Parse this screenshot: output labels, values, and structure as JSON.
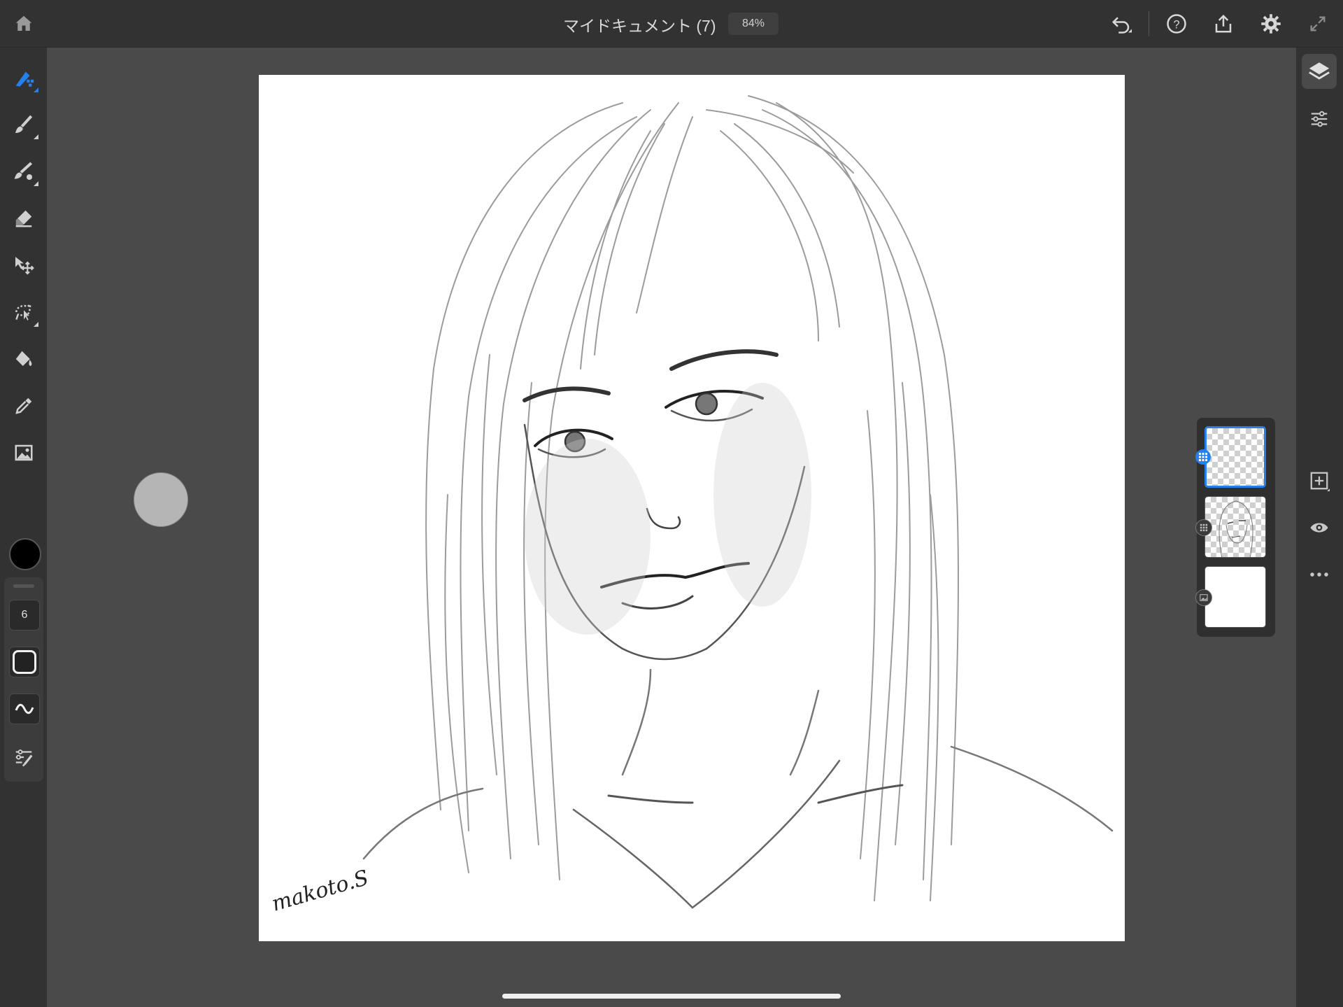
{
  "app": {
    "document_title": "マイドキュメント (7)",
    "zoom_level": "84%"
  },
  "toolbar_top": {
    "home": "home-icon",
    "undo": "undo-icon",
    "help": "help-icon",
    "share": "share-icon",
    "settings": "gear-icon",
    "fullscreen": "expand-icon"
  },
  "tools": [
    {
      "name": "pixel-brush",
      "icon": "pixel-brush-icon",
      "active": true
    },
    {
      "name": "live-brush",
      "icon": "live-brush-icon"
    },
    {
      "name": "vector-brush",
      "icon": "vector-brush-icon"
    },
    {
      "name": "eraser",
      "icon": "eraser-icon"
    },
    {
      "name": "transform",
      "icon": "transform-icon"
    },
    {
      "name": "selection",
      "icon": "lasso-icon"
    },
    {
      "name": "fill",
      "icon": "fill-bucket-icon"
    },
    {
      "name": "eyedropper",
      "icon": "eyedropper-icon"
    },
    {
      "name": "place-image",
      "icon": "image-icon"
    }
  ],
  "brush": {
    "color": "#000000",
    "size": "6",
    "opacity_icon": "opacity-icon",
    "flow_icon": "flow-icon",
    "settings_icon": "brush-settings-icon"
  },
  "canvas": {
    "signature": "makoto.S"
  },
  "right_toolbar": {
    "layers": "layers-icon",
    "layer_properties": "sliders-icon",
    "add_layer": "add-layer-icon",
    "visibility": "eye-icon",
    "more": "more-icon"
  },
  "layers": [
    {
      "name": "empty-pixel-layer",
      "selected": true,
      "badge": "pixel-layer-icon"
    },
    {
      "name": "sketch-layer",
      "selected": false,
      "badge": "pixel-layer-icon"
    },
    {
      "name": "background-layer",
      "selected": false,
      "badge": "image-layer-icon"
    }
  ],
  "colors": {
    "accent": "#2680eb",
    "panel": "#323232",
    "workspace": "#4a4a4a"
  }
}
